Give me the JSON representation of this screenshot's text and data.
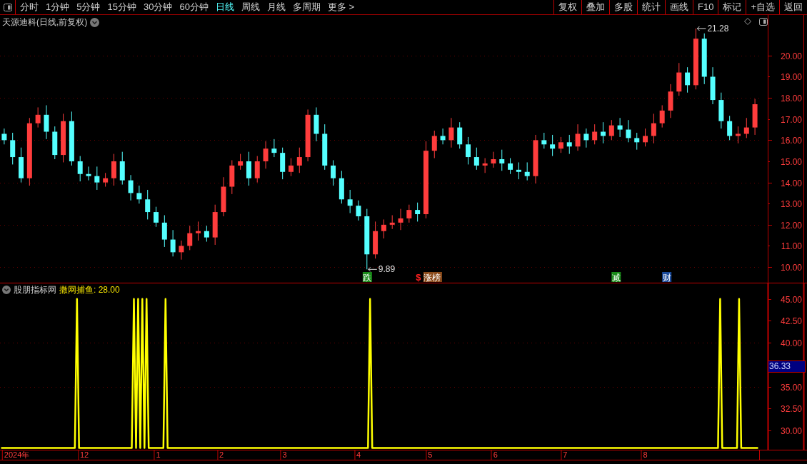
{
  "toolbar": {
    "periods": [
      {
        "label": "分时",
        "selected": false
      },
      {
        "label": "1分钟",
        "selected": false
      },
      {
        "label": "5分钟",
        "selected": false
      },
      {
        "label": "15分钟",
        "selected": false
      },
      {
        "label": "30分钟",
        "selected": false
      },
      {
        "label": "60分钟",
        "selected": false
      },
      {
        "label": "日线",
        "selected": true
      },
      {
        "label": "周线",
        "selected": false
      },
      {
        "label": "月线",
        "selected": false
      },
      {
        "label": "多周期",
        "selected": false
      },
      {
        "label": "更多 >",
        "selected": false
      }
    ],
    "actions": [
      "复权",
      "叠加",
      "多股",
      "统计",
      "画线",
      "F10",
      "标记",
      "+自选",
      "返回"
    ]
  },
  "price_pane": {
    "title": "天源迪科(日线,前复权)",
    "chart_data": {
      "type": "candlestick",
      "grid": true,
      "ylim": [
        9.26,
        21.92
      ],
      "yticks": [
        {
          "value": 20,
          "label": "20.00"
        },
        {
          "value": 19,
          "label": "19.00"
        },
        {
          "value": 18,
          "label": "18.00"
        },
        {
          "value": 17,
          "label": "17.00"
        },
        {
          "value": 16,
          "label": "16.00"
        },
        {
          "value": 15,
          "label": "15.00"
        },
        {
          "value": 14,
          "label": "14.00"
        },
        {
          "value": 13,
          "label": "13.00"
        },
        {
          "value": 12,
          "label": "12.00"
        },
        {
          "value": 11,
          "label": "11.00"
        },
        {
          "value": 10,
          "label": "10.00"
        }
      ],
      "categories": [
        null,
        null,
        null,
        null,
        null,
        null,
        null,
        null,
        null,
        null,
        null,
        null,
        null,
        null,
        null,
        null,
        null,
        null,
        null,
        null,
        null,
        null,
        null,
        null,
        null,
        null,
        null,
        null,
        null,
        null,
        null,
        null,
        null,
        null,
        null,
        null,
        null,
        null,
        null,
        null,
        null,
        null,
        null,
        null,
        null,
        null,
        null,
        null,
        null,
        null,
        null,
        null,
        null,
        null,
        null,
        null,
        null,
        null,
        null,
        null,
        null,
        null,
        null,
        null,
        null,
        null,
        null,
        null,
        null,
        null,
        null,
        null,
        null,
        null,
        null,
        null,
        null,
        null,
        null,
        null,
        null,
        null,
        null,
        null,
        null,
        null,
        null,
        null,
        null,
        null
      ],
      "ohlc": [
        [
          16.3,
          16.55,
          15.8,
          16.0
        ],
        [
          16.0,
          16.35,
          14.85,
          15.2
        ],
        [
          15.2,
          15.65,
          14.0,
          14.2
        ],
        [
          14.2,
          17.05,
          13.85,
          16.8
        ],
        [
          16.8,
          17.55,
          16.6,
          17.2
        ],
        [
          17.2,
          17.65,
          16.05,
          16.4
        ],
        [
          16.4,
          16.65,
          15.1,
          15.3
        ],
        [
          15.3,
          17.25,
          14.95,
          16.9
        ],
        [
          16.9,
          17.35,
          14.8,
          15.0
        ],
        [
          15.0,
          15.25,
          14.05,
          14.4
        ],
        [
          14.4,
          14.75,
          14.1,
          14.3
        ],
        [
          14.3,
          14.75,
          13.65,
          14.0
        ],
        [
          14.0,
          14.45,
          13.8,
          14.2
        ],
        [
          14.2,
          15.35,
          13.85,
          15.0
        ],
        [
          15.0,
          15.45,
          13.9,
          14.1
        ],
        [
          14.1,
          14.35,
          13.15,
          13.5
        ],
        [
          13.5,
          13.85,
          13.0,
          13.2
        ],
        [
          13.2,
          13.65,
          12.25,
          12.6
        ],
        [
          12.6,
          12.85,
          11.9,
          12.1
        ],
        [
          12.1,
          12.45,
          10.95,
          11.3
        ],
        [
          11.3,
          11.75,
          10.5,
          10.7
        ],
        [
          10.7,
          11.25,
          10.35,
          11.0
        ],
        [
          11.0,
          11.95,
          10.8,
          11.6
        ],
        [
          11.6,
          12.15,
          11.25,
          11.7
        ],
        [
          11.7,
          11.95,
          11.2,
          11.4
        ],
        [
          11.4,
          12.95,
          11.05,
          12.6
        ],
        [
          12.6,
          14.25,
          12.4,
          13.8
        ],
        [
          13.8,
          15.05,
          13.45,
          14.8
        ],
        [
          14.8,
          15.35,
          14.6,
          15.0
        ],
        [
          15.0,
          15.45,
          13.85,
          14.2
        ],
        [
          14.2,
          15.25,
          14.0,
          15.0
        ],
        [
          15.0,
          15.95,
          14.65,
          15.6
        ],
        [
          15.6,
          16.05,
          15.2,
          15.4
        ],
        [
          15.4,
          15.65,
          14.15,
          14.5
        ],
        [
          14.5,
          15.15,
          14.3,
          14.8
        ],
        [
          14.8,
          15.65,
          14.45,
          15.2
        ],
        [
          15.2,
          17.45,
          15.0,
          17.2
        ],
        [
          17.2,
          17.55,
          15.95,
          16.3
        ],
        [
          16.3,
          16.75,
          14.6,
          14.8
        ],
        [
          14.8,
          15.05,
          13.85,
          14.2
        ],
        [
          14.2,
          14.55,
          13.0,
          13.2
        ],
        [
          13.2,
          13.65,
          12.55,
          12.9
        ],
        [
          12.9,
          13.15,
          12.2,
          12.4
        ],
        [
          12.4,
          12.75,
          9.89,
          10.6
        ],
        [
          10.6,
          12.15,
          10.4,
          11.7
        ],
        [
          11.7,
          12.25,
          11.35,
          12.0
        ],
        [
          12.0,
          12.45,
          11.8,
          12.1
        ],
        [
          12.1,
          12.75,
          11.75,
          12.3
        ],
        [
          12.3,
          12.95,
          12.1,
          12.7
        ],
        [
          12.7,
          13.05,
          12.15,
          12.5
        ],
        [
          12.5,
          15.95,
          12.3,
          15.5
        ],
        [
          15.5,
          16.45,
          15.15,
          16.2
        ],
        [
          16.2,
          16.55,
          15.8,
          16.0
        ],
        [
          16.0,
          17.05,
          15.65,
          16.6
        ],
        [
          16.6,
          16.85,
          15.6,
          15.8
        ],
        [
          15.8,
          16.15,
          14.85,
          15.2
        ],
        [
          15.2,
          15.65,
          14.6,
          14.8
        ],
        [
          14.8,
          15.15,
          14.45,
          14.9
        ],
        [
          14.9,
          15.45,
          14.7,
          15.1
        ],
        [
          15.1,
          15.55,
          14.55,
          14.9
        ],
        [
          14.9,
          15.15,
          14.4,
          14.6
        ],
        [
          14.6,
          14.95,
          14.15,
          14.5
        ],
        [
          14.5,
          14.95,
          14.1,
          14.3
        ],
        [
          14.3,
          16.25,
          13.95,
          16.0
        ],
        [
          16.0,
          16.35,
          15.6,
          15.8
        ],
        [
          15.8,
          16.25,
          15.25,
          15.6
        ],
        [
          15.6,
          16.15,
          15.4,
          15.9
        ],
        [
          15.9,
          16.25,
          15.35,
          15.7
        ],
        [
          15.7,
          16.75,
          15.5,
          16.3
        ],
        [
          16.3,
          16.55,
          15.65,
          16.0
        ],
        [
          16.0,
          16.75,
          15.8,
          16.4
        ],
        [
          16.4,
          16.85,
          15.85,
          16.2
        ],
        [
          16.2,
          16.95,
          16.0,
          16.7
        ],
        [
          16.7,
          17.05,
          16.15,
          16.5
        ],
        [
          16.5,
          16.95,
          15.9,
          16.1
        ],
        [
          16.1,
          16.35,
          15.55,
          15.9
        ],
        [
          15.9,
          16.55,
          15.7,
          16.2
        ],
        [
          16.2,
          17.25,
          15.85,
          16.8
        ],
        [
          16.8,
          17.65,
          16.6,
          17.4
        ],
        [
          17.4,
          18.65,
          17.05,
          18.3
        ],
        [
          18.3,
          19.65,
          18.1,
          19.2
        ],
        [
          19.2,
          19.45,
          18.25,
          18.6
        ],
        [
          18.6,
          21.28,
          18.4,
          20.8
        ],
        [
          20.8,
          21.05,
          18.65,
          19.0
        ],
        [
          19.0,
          19.45,
          17.7,
          17.9
        ],
        [
          17.9,
          18.25,
          16.55,
          16.9
        ],
        [
          16.9,
          17.15,
          16.0,
          16.2
        ],
        [
          16.2,
          16.65,
          15.85,
          16.3
        ],
        [
          16.3,
          17.05,
          16.1,
          16.6
        ],
        [
          16.6,
          17.95,
          16.25,
          17.7
        ]
      ],
      "annotations": [
        "21.28",
        "9.89"
      ]
    },
    "signals": [
      {
        "text": "跌",
        "color": "#188a18"
      },
      {
        "text": "$",
        "color": "#ff2020"
      },
      {
        "text": "涨榜",
        "color": "#8a4a1a"
      },
      {
        "text": "减",
        "color": "#188a18"
      },
      {
        "text": "财",
        "color": "#1a4a9a"
      }
    ]
  },
  "indicator_pane": {
    "name": "股朋指标网",
    "reading": "撒网捕鱼: 28.00",
    "cursor_value": "36.33",
    "chart_data": {
      "type": "line",
      "grid": true,
      "ylim": [
        27.8,
        46.6
      ],
      "yticks": [
        {
          "value": 45,
          "label": "45.00"
        },
        {
          "value": 42.5,
          "label": "42.50"
        },
        {
          "value": 40,
          "label": "40.00"
        },
        {
          "value": 35,
          "label": "35.00"
        },
        {
          "value": 32.5,
          "label": "32.50"
        },
        {
          "value": 30,
          "label": "30.00"
        }
      ],
      "categories": [
        null,
        null,
        null,
        null,
        null,
        null,
        null,
        "2024年",
        null,
        null,
        null,
        null,
        null,
        null,
        null,
        null,
        null,
        null,
        null,
        null,
        null,
        null,
        null,
        null,
        null,
        null,
        null,
        null,
        null,
        null,
        null,
        null,
        null,
        null,
        null,
        null,
        null,
        null,
        null,
        "12",
        null,
        null,
        null,
        null,
        null,
        null,
        null,
        null,
        null,
        null,
        null,
        null,
        null,
        null,
        null,
        null,
        null,
        null,
        null,
        null,
        null,
        null,
        null,
        null,
        null,
        null,
        null,
        null,
        null,
        null,
        null,
        null,
        null,
        null,
        "1",
        null,
        null,
        null,
        null,
        null,
        null,
        null,
        null,
        null,
        null,
        null,
        null,
        null,
        null,
        null,
        null,
        null,
        null,
        null,
        null,
        null,
        null,
        null,
        null,
        null,
        null,
        null,
        null,
        null,
        "2",
        null,
        null,
        null,
        null,
        null,
        null,
        null,
        null,
        null,
        null,
        null,
        null,
        null,
        null,
        null,
        null,
        null,
        null,
        null,
        null,
        null,
        null,
        null,
        null,
        null,
        null,
        null,
        null,
        null,
        "3",
        null,
        null,
        null,
        null,
        null,
        null,
        null,
        null,
        null,
        null,
        null,
        null,
        null,
        null,
        null,
        null,
        null,
        null,
        null,
        null,
        null,
        null,
        null,
        null,
        null,
        null,
        null,
        null,
        null,
        null,
        null,
        null,
        null,
        null,
        "4",
        null,
        null,
        null,
        null,
        null,
        null,
        null,
        null,
        null,
        null,
        null,
        null,
        null,
        null,
        null,
        null,
        null,
        null,
        null,
        null,
        null,
        null,
        null,
        null,
        null,
        null,
        null,
        null,
        null,
        null,
        null,
        null,
        null,
        "5",
        null,
        null,
        null,
        null,
        null,
        null,
        null,
        null,
        null,
        null,
        null,
        null,
        null,
        null,
        null,
        null,
        null,
        null,
        null,
        null,
        null,
        null,
        null,
        null,
        null,
        null,
        null,
        null,
        null,
        null,
        "6",
        null,
        null,
        null,
        null,
        null,
        null,
        null,
        null,
        null,
        null,
        null,
        null,
        null,
        null,
        null,
        null,
        null,
        null,
        null,
        null,
        null,
        null,
        null,
        null,
        null,
        null,
        null,
        null,
        null,
        null,
        null,
        null,
        "7",
        null,
        null,
        null,
        null,
        null,
        null,
        null,
        null,
        null,
        null,
        null,
        null,
        null,
        null,
        null,
        null,
        null,
        null,
        null,
        null,
        null,
        null,
        null,
        null,
        null,
        null,
        null,
        null,
        null,
        null,
        null,
        null,
        null,
        null,
        null,
        null,
        null,
        "8",
        null,
        null,
        null,
        null,
        null,
        null,
        null,
        null,
        null,
        null,
        null,
        null,
        null,
        null,
        null,
        null,
        null,
        null,
        null,
        null,
        null,
        null,
        null,
        null,
        null,
        null,
        null,
        null,
        null,
        null,
        null,
        null,
        null,
        null,
        null,
        null,
        null,
        null,
        null,
        null,
        null,
        null,
        null,
        null,
        null,
        null,
        null,
        null,
        null,
        null,
        null,
        null,
        null,
        null
      ],
      "series": [
        {
          "color": "#ffff00",
          "values": [
            28,
            28,
            28,
            28,
            28,
            28,
            28,
            28,
            28,
            28,
            28,
            28,
            28,
            28,
            28,
            28,
            28,
            28,
            28,
            28,
            28,
            28,
            28,
            28,
            28,
            28,
            28,
            28,
            28,
            28,
            28,
            28,
            28,
            28,
            28,
            28,
            45,
            28,
            28,
            28,
            28,
            28,
            28,
            28,
            28,
            28,
            28,
            28,
            28,
            28,
            28,
            28,
            28,
            28,
            28,
            28,
            28,
            28,
            28,
            28,
            28,
            28,
            28,
            45,
            28,
            45,
            28,
            45,
            28,
            45,
            28,
            28,
            28,
            28,
            28,
            28,
            28,
            28,
            45,
            28,
            28,
            28,
            28,
            28,
            28,
            28,
            28,
            28,
            28,
            28,
            28,
            28,
            28,
            28,
            28,
            28,
            28,
            28,
            28,
            28,
            28,
            28,
            28,
            28,
            28,
            28,
            28,
            28,
            28,
            28,
            28,
            28,
            28,
            28,
            28,
            28,
            28,
            28,
            28,
            28,
            28,
            28,
            28,
            28,
            28,
            28,
            28,
            28,
            28,
            28,
            28,
            28,
            28,
            28,
            28,
            28,
            28,
            28,
            28,
            28,
            28,
            28,
            28,
            28,
            28,
            28,
            28,
            28,
            28,
            28,
            28,
            28,
            28,
            28,
            28,
            28,
            28,
            28,
            28,
            28,
            28,
            28,
            28,
            28,
            28,
            28,
            28,
            28,
            28,
            28,
            28,
            28,
            28,
            28,
            28,
            45,
            28,
            28,
            28,
            28,
            28,
            28,
            28,
            28,
            28,
            28,
            28,
            28,
            28,
            28,
            28,
            28,
            28,
            28,
            28,
            28,
            28,
            28,
            28,
            28,
            28,
            28,
            28,
            28,
            28,
            28,
            28,
            28,
            28,
            28,
            28,
            28,
            28,
            28,
            28,
            28,
            28,
            28,
            28,
            28,
            28,
            28,
            28,
            28,
            28,
            28,
            28,
            28,
            28,
            28,
            28,
            28,
            28,
            28,
            28,
            28,
            28,
            28,
            28,
            28,
            28,
            28,
            28,
            28,
            28,
            28,
            28,
            28,
            28,
            28,
            28,
            28,
            28,
            28,
            28,
            28,
            28,
            28,
            28,
            28,
            28,
            28,
            28,
            28,
            28,
            28,
            28,
            28,
            28,
            28,
            28,
            28,
            28,
            28,
            28,
            28,
            28,
            28,
            28,
            28,
            28,
            28,
            28,
            28,
            28,
            28,
            28,
            28,
            28,
            28,
            28,
            28,
            28,
            28,
            28,
            28,
            28,
            28,
            28,
            28,
            28,
            28,
            28,
            28,
            28,
            28,
            28,
            28,
            28,
            28,
            28,
            28,
            28,
            28,
            28,
            28,
            28,
            28,
            28,
            28,
            28,
            28,
            28,
            28,
            28,
            28,
            28,
            28,
            28,
            28,
            28,
            28,
            28,
            28,
            28,
            28,
            28,
            28,
            28,
            28,
            28,
            45,
            28,
            28,
            28,
            28,
            28,
            28,
            28,
            28,
            45,
            28,
            28,
            28,
            28,
            28,
            28,
            28,
            28,
            28
          ]
        }
      ]
    }
  }
}
